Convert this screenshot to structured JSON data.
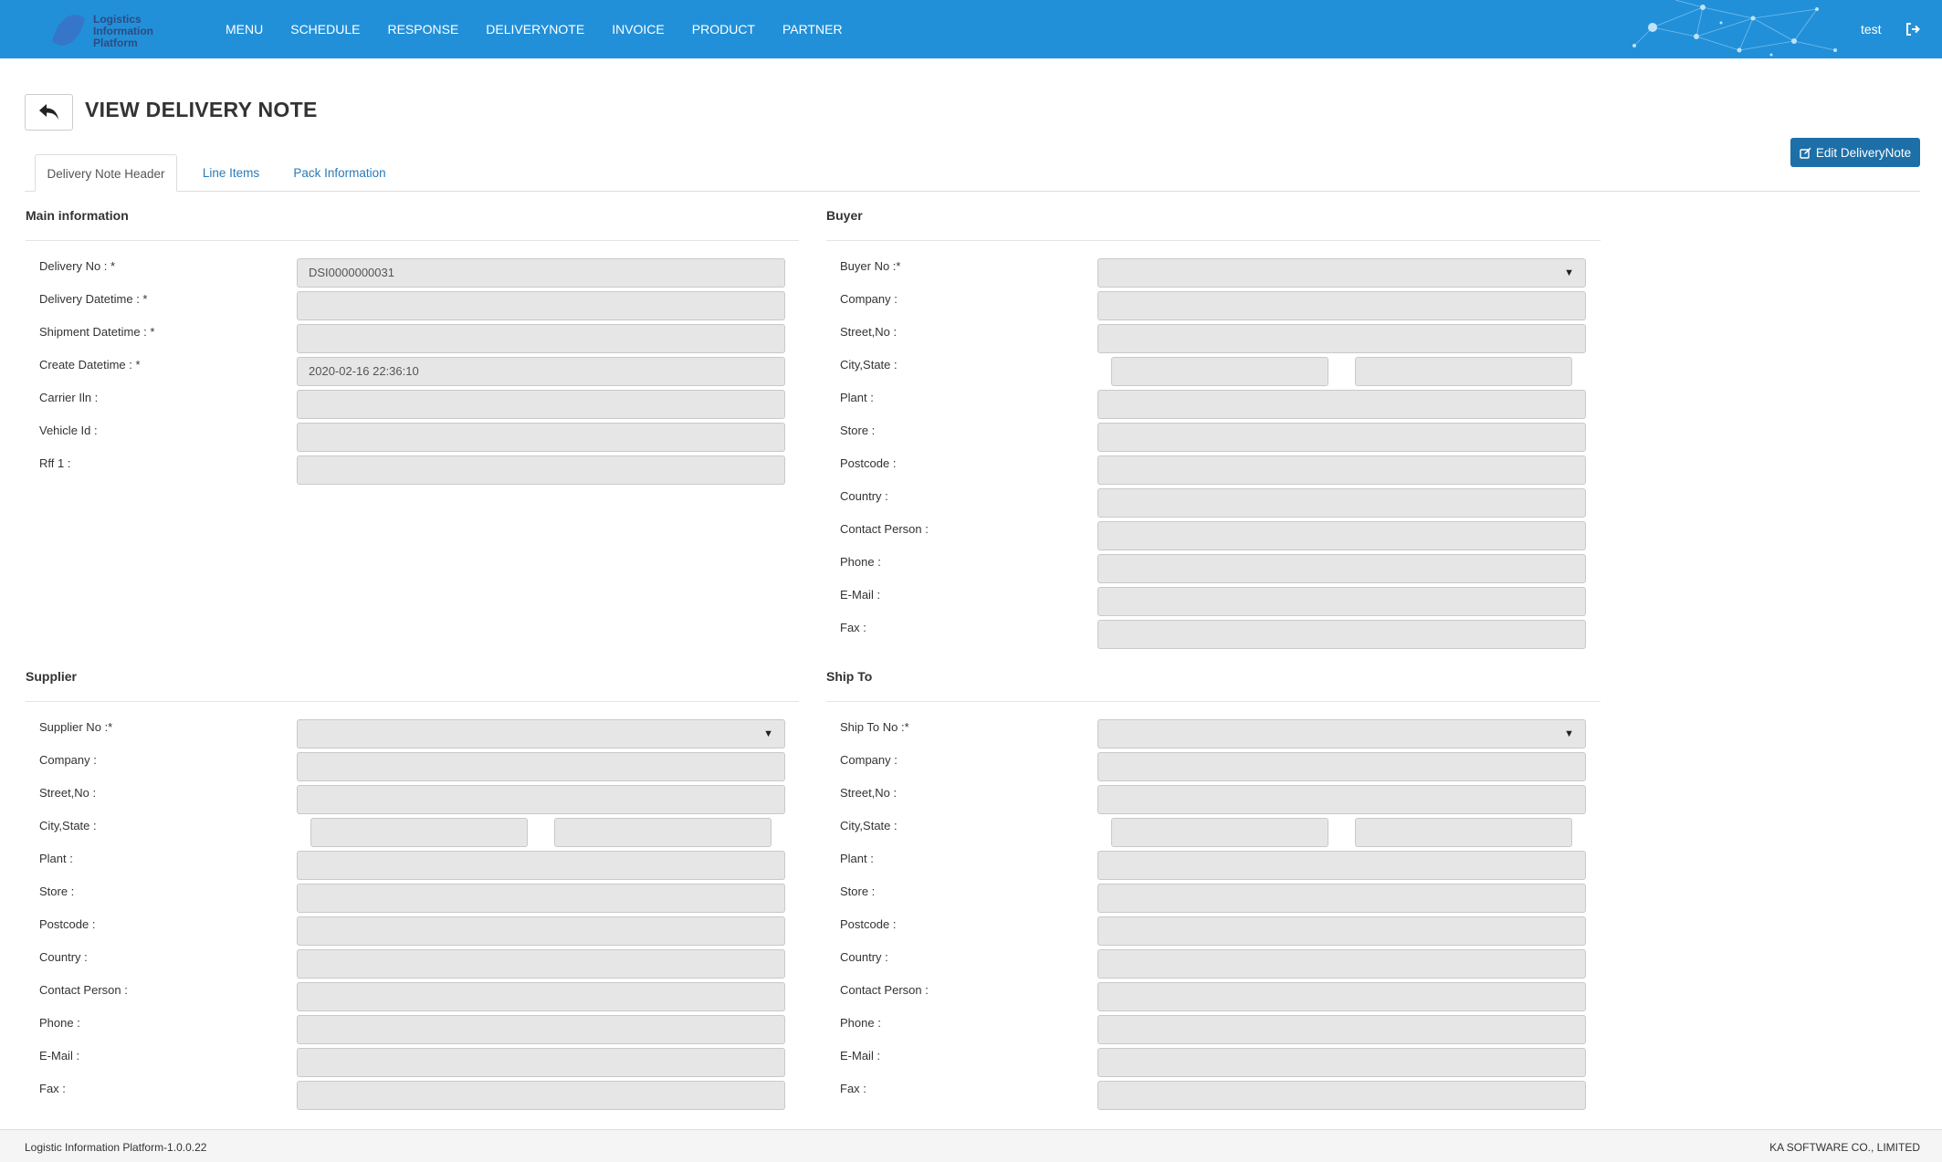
{
  "brand": {
    "line1": "Logistics",
    "line2": "Information",
    "line3": "Platform"
  },
  "nav": [
    "MENU",
    "SCHEDULE",
    "RESPONSE",
    "DELIVERYNOTE",
    "INVOICE",
    "PRODUCT",
    "PARTNER"
  ],
  "user": "test",
  "page_title": "VIEW DELIVERY NOTE",
  "edit_button": "Edit DeliveryNote",
  "tabs": [
    "Delivery Note Header",
    "Line Items",
    "Pack Information"
  ],
  "main": {
    "title": "Main information",
    "fields": [
      {
        "label": "Delivery No : *",
        "value": "DSI0000000031"
      },
      {
        "label": "Delivery Datetime : *",
        "value": ""
      },
      {
        "label": "Shipment Datetime : *",
        "value": ""
      },
      {
        "label": "Create Datetime : *",
        "value": "2020-02-16 22:36:10"
      },
      {
        "label": "Carrier Iln :",
        "value": ""
      },
      {
        "label": "Vehicle Id :",
        "value": ""
      },
      {
        "label": "Rff 1 :",
        "value": ""
      }
    ]
  },
  "buyer": {
    "title": "Buyer",
    "labels": [
      "Buyer No :*",
      "Company :",
      "Street,No :",
      "City,State :",
      "Plant :",
      "Store :",
      "Postcode :",
      "Country :",
      "Contact Person :",
      "Phone :",
      "E-Mail :",
      "Fax :"
    ]
  },
  "supplier": {
    "title": "Supplier",
    "labels": [
      "Supplier No :*",
      "Company :",
      "Street,No :",
      "City,State :",
      "Plant :",
      "Store :",
      "Postcode :",
      "Country :",
      "Contact Person :",
      "Phone :",
      "E-Mail :",
      "Fax :"
    ]
  },
  "shipto": {
    "title": "Ship To",
    "labels": [
      "Ship To No :*",
      "Company :",
      "Street,No :",
      "City,State :",
      "Plant :",
      "Store :",
      "Postcode :",
      "Country :",
      "Contact Person :",
      "Phone :",
      "E-Mail :",
      "Fax :"
    ]
  },
  "footer": {
    "left": "Logistic Information Platform-1.0.0.22",
    "right": "KA SOFTWARE CO., LIMITED"
  },
  "colors": {
    "header": "#2190d9",
    "button": "#1d6fa8",
    "input_bg": "#e6e6e6"
  }
}
